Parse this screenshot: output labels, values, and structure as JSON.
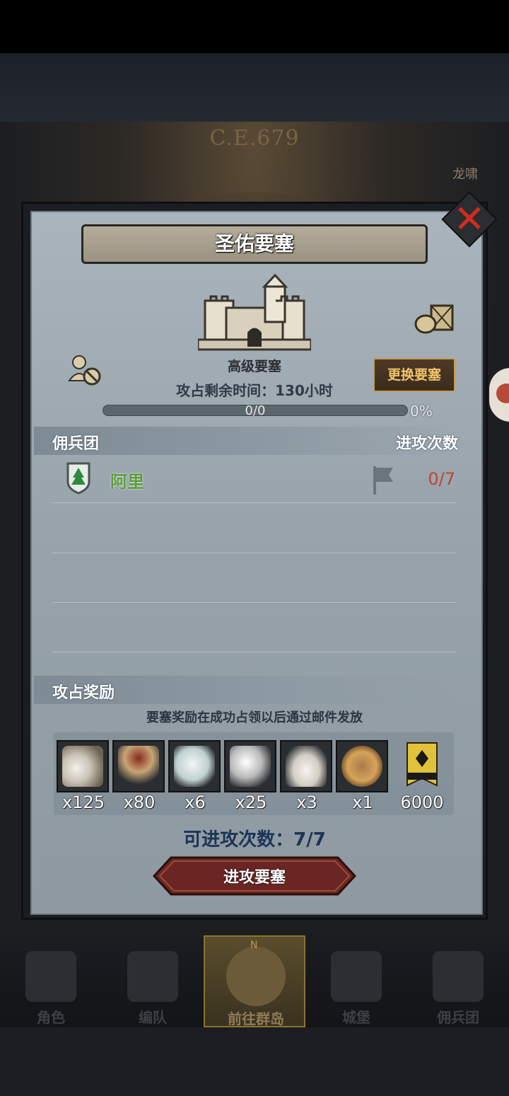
{
  "map": {
    "year": "C.E.679",
    "side_label": "龙啸"
  },
  "dialog": {
    "title": "圣佑要塞",
    "fortress_grade": "高级要塞",
    "swap_button": "更换要塞",
    "time_label": "攻占剩余时间：130小时",
    "progress": {
      "text": "0/0",
      "percent_label": "0%",
      "fraction": 0.0
    },
    "merc_section": {
      "left": "佣兵团",
      "right": "进攻次数"
    },
    "merc_rows": [
      {
        "name": "阿里",
        "count": "0/7"
      }
    ],
    "reward_section": {
      "left": "攻占奖励"
    },
    "reward_note": "要塞奖励在成功占领以后通过邮件发放",
    "rewards": [
      {
        "icon": "ore-sack-icon",
        "qty": "x125"
      },
      {
        "icon": "goblet-icon",
        "qty": "x80"
      },
      {
        "icon": "gem-stone-icon",
        "qty": "x6"
      },
      {
        "icon": "silver-coins-icon",
        "qty": "x25"
      },
      {
        "icon": "salt-pile-icon",
        "qty": "x3"
      },
      {
        "icon": "knight-medal-icon",
        "qty": "x1"
      },
      {
        "icon": "guild-banner-icon",
        "qty": "6000"
      }
    ],
    "attack_count": "可进攻次数：7/7",
    "attack_button": "进攻要塞"
  },
  "nav": [
    {
      "label": "角色",
      "icon": "character-icon"
    },
    {
      "label": "编队",
      "icon": "formation-icon"
    },
    {
      "label": "前往群岛",
      "icon": "compass-icon",
      "active": true
    },
    {
      "label": "城堡",
      "icon": "castle-icon"
    },
    {
      "label": "佣兵团",
      "icon": "mercenary-icon"
    }
  ],
  "colors": {
    "accent": "#c49a52",
    "merc_name": "#5d9c3a",
    "count_red": "#c0432f",
    "close": "#d42a1e"
  }
}
